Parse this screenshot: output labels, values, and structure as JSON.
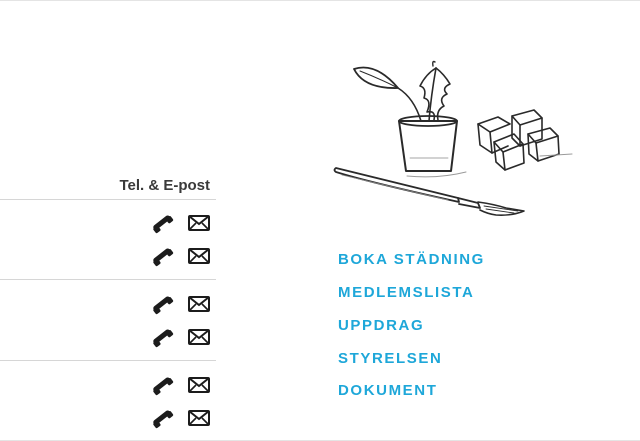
{
  "contacts": {
    "header": "Tel. & E-post",
    "groups": [
      {
        "rows": [
          {
            "phone_icon": "phone-icon",
            "mail_icon": "envelope-icon"
          },
          {
            "phone_icon": "phone-icon",
            "mail_icon": "envelope-icon"
          }
        ]
      },
      {
        "rows": [
          {
            "phone_icon": "phone-icon",
            "mail_icon": "envelope-icon"
          },
          {
            "phone_icon": "phone-icon",
            "mail_icon": "envelope-icon"
          }
        ]
      },
      {
        "rows": [
          {
            "phone_icon": "phone-icon",
            "mail_icon": "envelope-icon"
          },
          {
            "phone_icon": "phone-icon",
            "mail_icon": "envelope-icon"
          }
        ]
      }
    ]
  },
  "illustration": {
    "elements": [
      "plant-pot-drawing",
      "sugar-cubes-drawing",
      "paintbrush-drawing"
    ]
  },
  "nav": {
    "links": [
      "BOKA STÄDNING",
      "MEDLEMSLISTA",
      "UPPDRAG",
      "STYRELSEN",
      "DOKUMENT"
    ]
  },
  "colors": {
    "link": "#1ea7d9",
    "text": "#333333",
    "divider": "#d6d6d6"
  }
}
